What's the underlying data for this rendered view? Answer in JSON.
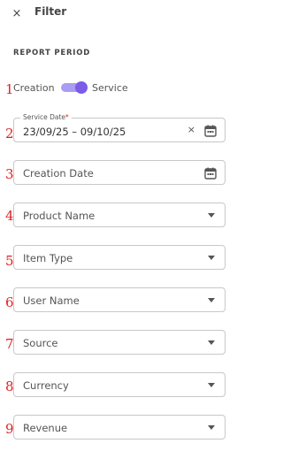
{
  "header": {
    "close_icon": "×",
    "title": "Filter"
  },
  "section": {
    "title": "REPORT PERIOD"
  },
  "annotations": [
    "1",
    "2",
    "3",
    "4",
    "5",
    "6",
    "7",
    "8",
    "9"
  ],
  "period_toggle": {
    "left_label": "Creation",
    "right_label": "Service",
    "selected": "Service",
    "accent_color": "#7b5ce6"
  },
  "service_date": {
    "label": "Service Date",
    "required_mark": "*",
    "value": "23/09/25 – 09/10/25",
    "clear_icon": "×",
    "icon": "calendar-icon"
  },
  "creation_date": {
    "placeholder": "Creation Date",
    "icon": "calendar-icon"
  },
  "dropdowns": {
    "product_name": "Product Name",
    "item_type": "Item Type",
    "user_name": "User Name",
    "source": "Source",
    "currency": "Currency",
    "revenue": "Revenue"
  }
}
